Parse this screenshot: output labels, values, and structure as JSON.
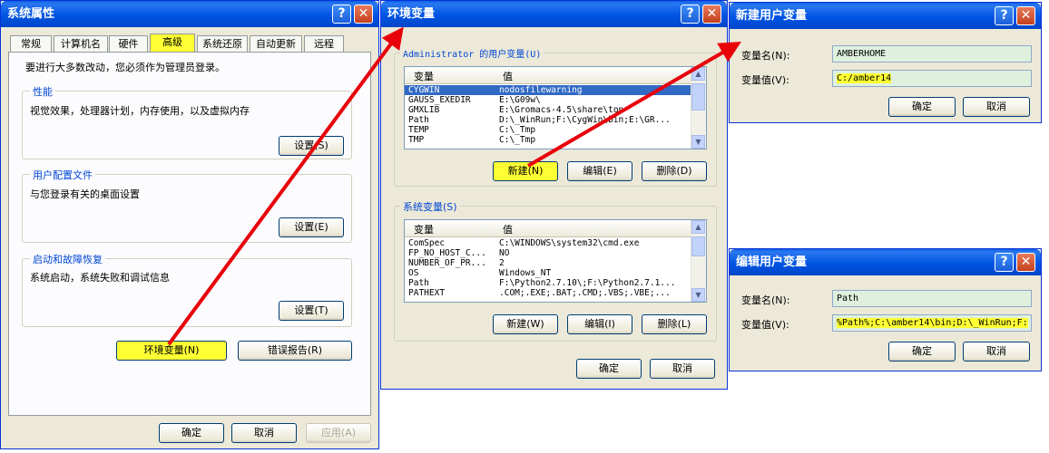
{
  "sys_props": {
    "title": "系统属性",
    "tabs": [
      "常规",
      "计算机名",
      "硬件",
      "高级",
      "系统还原",
      "自动更新",
      "远程"
    ],
    "admin_note": "要进行大多数改动，您必须作为管理员登录。",
    "perf": {
      "label": "性能",
      "desc": "视觉效果，处理器计划，内存使用，以及虚拟内存",
      "button": "设置(S)"
    },
    "profile": {
      "label": "用户配置文件",
      "desc": "与您登录有关的桌面设置",
      "button": "设置(E)"
    },
    "startup": {
      "label": "启动和故障恢复",
      "desc": "系统启动，系统失败和调试信息",
      "button": "设置(T)"
    },
    "env_button": "环境变量(N)",
    "error_button": "错误报告(R)",
    "ok": "确定",
    "cancel": "取消",
    "apply": "应用(A)"
  },
  "env_vars": {
    "title": "环境变量",
    "user_label": "Administrator 的用户变量(U)",
    "col_var": "变量",
    "col_val": "值",
    "user_rows": [
      {
        "name": "CYGWIN",
        "value": "nodosfilewarning"
      },
      {
        "name": "GAUSS_EXEDIR",
        "value": "E:\\G09w\\"
      },
      {
        "name": "GMXLIB",
        "value": "E:\\Gromacs-4.5\\share\\top"
      },
      {
        "name": "Path",
        "value": "D:\\_WinRun;F:\\CygWin\\bin;E:\\GR..."
      },
      {
        "name": "TEMP",
        "value": "C:\\_Tmp"
      },
      {
        "name": "TMP",
        "value": "C:\\_Tmp"
      }
    ],
    "user_new": "新建(N)",
    "user_edit": "编辑(E)",
    "user_delete": "删除(D)",
    "sys_label": "系统变量(S)",
    "sys_rows": [
      {
        "name": "ComSpec",
        "value": "C:\\WINDOWS\\system32\\cmd.exe"
      },
      {
        "name": "FP_NO_HOST_C...",
        "value": "NO"
      },
      {
        "name": "NUMBER_OF_PR...",
        "value": "2"
      },
      {
        "name": "OS",
        "value": "Windows_NT"
      },
      {
        "name": "Path",
        "value": "F:\\Python2.7.10\\;F:\\Python2.7.1..."
      },
      {
        "name": "PATHEXT",
        "value": ".COM;.EXE;.BAT;.CMD;.VBS;.VBE;..."
      }
    ],
    "sys_new": "新建(W)",
    "sys_edit": "编辑(I)",
    "sys_delete": "删除(L)",
    "ok": "确定",
    "cancel": "取消"
  },
  "new_var": {
    "title": "新建用户变量",
    "name_label": "变量名(N):",
    "name_value": "AMBERHOME",
    "value_label": "变量值(V):",
    "value_value": "C:/amber14",
    "ok": "确定",
    "cancel": "取消"
  },
  "edit_var": {
    "title": "编辑用户变量",
    "name_label": "变量名(N):",
    "name_value": "Path",
    "value_label": "变量值(V):",
    "value_value": "%Path%;C:\\amber14\\bin;D:\\_WinRun;F:",
    "ok": "确定",
    "cancel": "取消"
  },
  "icons": {
    "help": "help-icon",
    "close": "close-icon",
    "arrow": "red-arrow-annotation"
  },
  "colors": {
    "titlebar": "#0054e3",
    "highlight": "#ffff33",
    "arrow": "#e8000b",
    "selection": "#316ac5"
  }
}
